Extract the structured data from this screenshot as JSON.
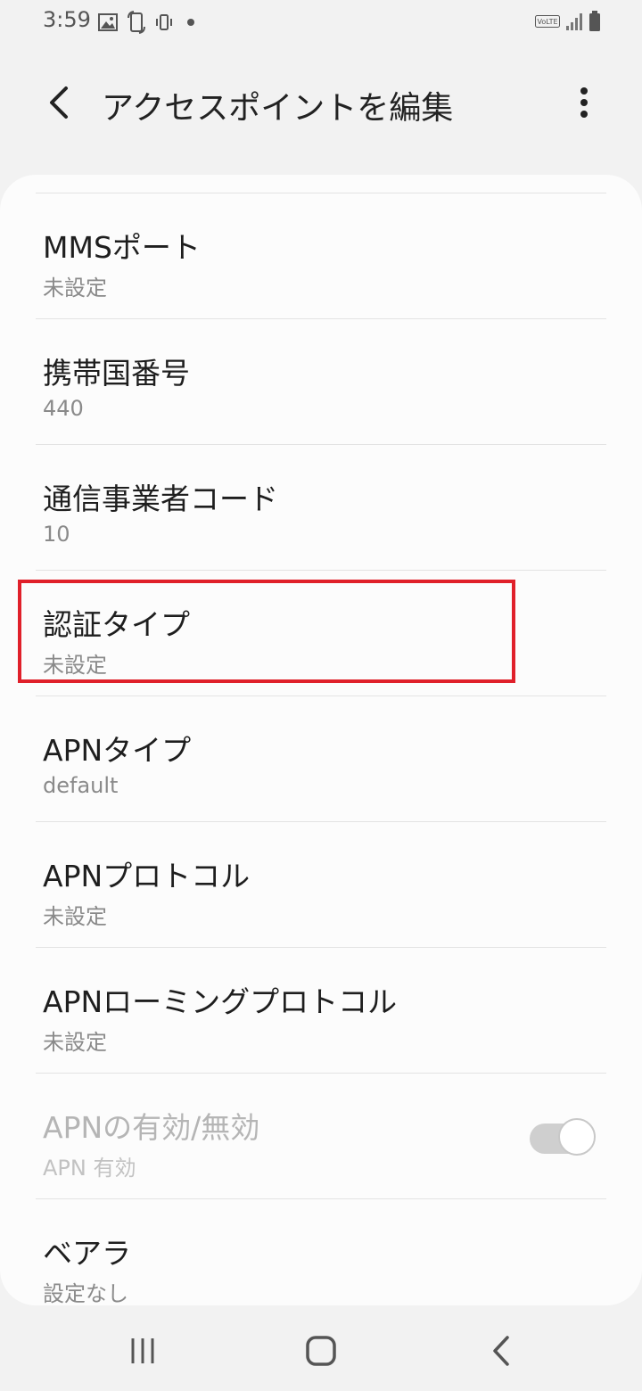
{
  "status_bar": {
    "time": "3:59",
    "left_icons": [
      "image-icon",
      "screen-rotate-icon",
      "phone-vibrate-icon",
      "dot-icon"
    ],
    "right_icons": [
      "volte-icon",
      "signal-icon",
      "battery-icon"
    ],
    "volte_label": "VoLTE"
  },
  "app_bar": {
    "title": "アクセスポイントを編集"
  },
  "items": [
    {
      "title": "MMSポート",
      "subtitle": "未設定"
    },
    {
      "title": "携帯国番号",
      "subtitle": "440"
    },
    {
      "title": "通信事業者コード",
      "subtitle": "10"
    },
    {
      "title": "認証タイプ",
      "subtitle": "未設定"
    },
    {
      "title": "APNタイプ",
      "subtitle": "default"
    },
    {
      "title": "APNプロトコル",
      "subtitle": "未設定"
    },
    {
      "title": "APNローミングプロトコル",
      "subtitle": "未設定"
    },
    {
      "title": "APNの有効/無効",
      "subtitle": "APN 有効",
      "toggle_on": true,
      "disabled": true
    },
    {
      "title": "ベアラ",
      "subtitle": "設定なし"
    }
  ],
  "colors": {
    "highlight": "#e0202a",
    "background": "#f2f2f2",
    "card": "#fcfcfc"
  }
}
